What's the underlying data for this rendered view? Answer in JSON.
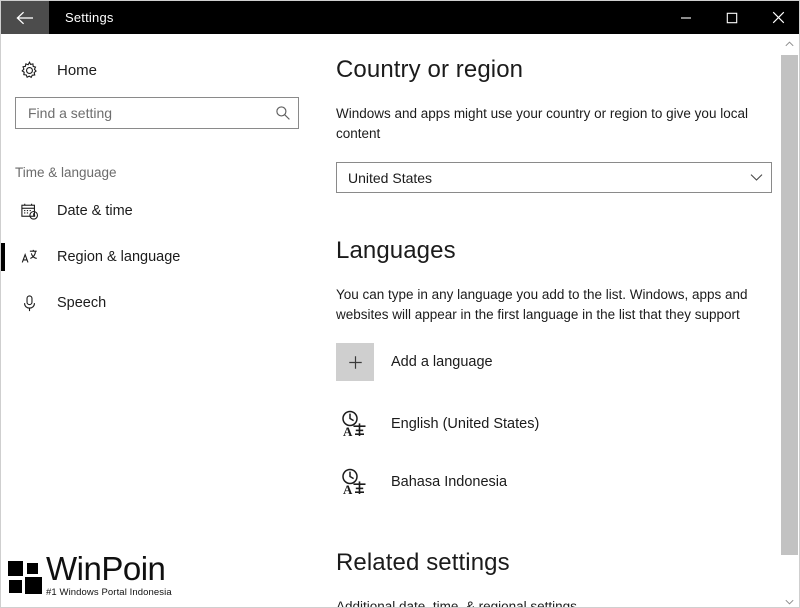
{
  "window": {
    "title": "Settings",
    "back_icon": "back-arrow-icon",
    "controls": {
      "minimize": "minimize-icon",
      "maximize": "maximize-icon",
      "close": "close-icon"
    }
  },
  "sidebar": {
    "home": {
      "label": "Home",
      "icon": "gear-icon"
    },
    "search": {
      "placeholder": "Find a setting",
      "value": "",
      "icon": "search-icon"
    },
    "group_header": "Time & language",
    "items": [
      {
        "label": "Date & time",
        "icon": "calendar-clock-icon",
        "selected": false
      },
      {
        "label": "Region & language",
        "icon": "language-region-icon",
        "selected": true
      },
      {
        "label": "Speech",
        "icon": "microphone-icon",
        "selected": false
      }
    ]
  },
  "main": {
    "country": {
      "title": "Country or region",
      "description": "Windows and apps might use your country or region to give you local content",
      "dropdown_value": "United States",
      "dropdown_icon": "chevron-down-icon"
    },
    "languages": {
      "title": "Languages",
      "description": "You can type in any language you add to the list. Windows, apps and websites will appear in the first language in the list that they support",
      "add_label": "Add a language",
      "add_icon": "plus-icon",
      "items": [
        {
          "label": "English (United States)",
          "icon": "language-pack-icon"
        },
        {
          "label": "Bahasa Indonesia",
          "icon": "language-pack-icon"
        }
      ]
    },
    "related": {
      "title": "Related settings",
      "links": [
        {
          "label": "Additional date, time, & regional settings"
        }
      ]
    }
  },
  "scrollbar": {
    "up_icon": "chevron-up-icon",
    "down_icon": "chevron-down-icon"
  },
  "watermark": {
    "name": "WinPoin",
    "tagline": "#1 Windows Portal Indonesia"
  },
  "colors": {
    "titlebar_bg": "#000000",
    "back_btn_bg": "#4c4c4c",
    "accent_selected": "#000000",
    "plus_box_bg": "#cfcfcf",
    "scroll_thumb": "#c2c2c2",
    "text_primary": "#1b1b1b",
    "text_muted": "#6b6b6b"
  }
}
